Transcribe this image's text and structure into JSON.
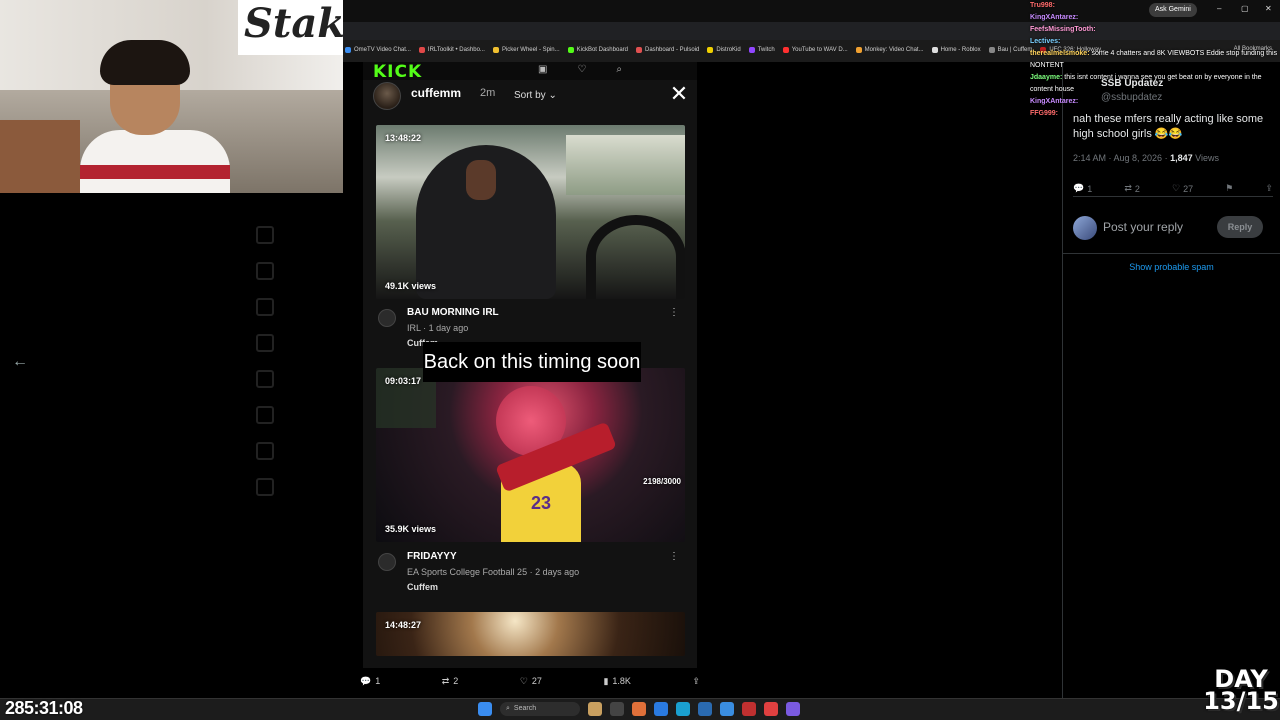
{
  "browser": {
    "ask_gemini": "Ask Gemini",
    "all_bookmarks": "All Bookmarks",
    "bookmarks": [
      {
        "label": "OmeTV Video Chat...",
        "color": "#3a8df0"
      },
      {
        "label": "IRLToolkit • Dashbo...",
        "color": "#e04848"
      },
      {
        "label": "Picker Wheel - Spin...",
        "color": "#f0c030"
      },
      {
        "label": "KickBot Dashboard",
        "color": "#53fc18"
      },
      {
        "label": "Dashboard - Pulsoid",
        "color": "#e05050"
      },
      {
        "label": "DistroKid",
        "color": "#f0d000"
      },
      {
        "label": "Twitch",
        "color": "#9146ff"
      },
      {
        "label": "YouTube to WAV D...",
        "color": "#ff3030"
      },
      {
        "label": "Monkey: Video Chat...",
        "color": "#f0a030"
      },
      {
        "label": "Home - Roblox",
        "color": "#dddddd"
      },
      {
        "label": "Bau | Cuffem",
        "color": "#888888"
      },
      {
        "label": "UFC 326: Holloway...",
        "color": "#c02020"
      }
    ]
  },
  "chat": [
    {
      "user": "Tru998:",
      "text": "",
      "color": "#ff6b6b"
    },
    {
      "user": "KingXAntarez:",
      "text": "",
      "color": "#c78bff"
    },
    {
      "user": "FeefsMissingTooth:",
      "text": "",
      "color": "#ff9ad5"
    },
    {
      "user": "Lectives:",
      "text": "",
      "color": "#7ad0ff"
    },
    {
      "user": "therealmelsmoke:",
      "text": "some 4 chatters and 8K VIEWBOTS Eddie stop funding this",
      "color": "#ffd35c"
    },
    {
      "user": "",
      "text": "NONTENT",
      "color": "#ffffff"
    },
    {
      "user": "Jdaayme:",
      "text": "this isnt content i wanna see you get beat on by everyone in the content house",
      "color": "#7dff7d"
    },
    {
      "user": "KingXAntarez:",
      "text": "",
      "color": "#c78bff"
    },
    {
      "user": "FFG999:",
      "text": "",
      "color": "#ff6b6b"
    }
  ],
  "tweet": {
    "author": "SSB Updatez",
    "handle": "@ssbupdatez",
    "text": "nah these mfers really acting like some high school girls 😂😂",
    "time": "2:14 AM · Aug 8, 2026 ·",
    "views_count": "1,847",
    "views_label": "Views",
    "replies": "1",
    "reposts": "2",
    "likes": "27",
    "reply_placeholder": "Post your reply",
    "reply_button": "Reply",
    "show_spam": "Show probable spam"
  },
  "modal": {
    "logo": "KICK",
    "channel": "cuffemm",
    "time_ago": "2m",
    "sort_label": "Sort by",
    "videos": [
      {
        "duration": "13:48:22",
        "views": "49.1K views",
        "title": "BAU MORNING IRL",
        "subtitle": "IRL · 1 day ago",
        "channel": "Cuffem"
      },
      {
        "duration": "09:03:17",
        "views": "35.9K views",
        "counter": "2198/3000",
        "title": "FRIDAYYY",
        "subtitle": "EA Sports College Football 25 · 2 days ago",
        "channel": "Cuffem"
      },
      {
        "duration": "14:48:27"
      }
    ],
    "caption": "Back on this timing soon"
  },
  "stats_bar": {
    "replies": "1",
    "reposts": "2",
    "likes": "27",
    "views": "1.8K"
  },
  "overlay": {
    "timer": "285:31:08",
    "day_label": "DAY",
    "day_count": "13/15"
  },
  "taskbar": {
    "search": "Search"
  }
}
